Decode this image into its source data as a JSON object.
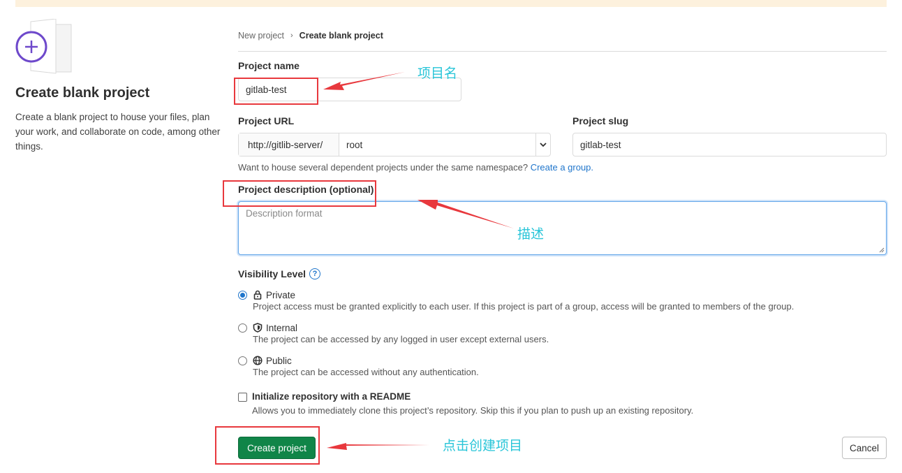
{
  "left": {
    "title": "Create blank project",
    "description": "Create a blank project to house your files, plan your work, and collaborate on code, among other things."
  },
  "breadcrumb": {
    "parent": "New project",
    "current": "Create blank project"
  },
  "form": {
    "project_name_label": "Project name",
    "project_name_value": "gitlab-test",
    "project_url_label": "Project URL",
    "url_prefix": "http://gitlib-server/",
    "namespace_value": "root",
    "project_slug_label": "Project slug",
    "project_slug_value": "gitlab-test",
    "namespace_help": "Want to house several dependent projects under the same namespace?",
    "namespace_help_link": "Create a group.",
    "description_label": "Project description (optional)",
    "description_placeholder": "Description format"
  },
  "visibility": {
    "label": "Visibility Level",
    "options": [
      {
        "title": "Private",
        "icon": "lock-icon",
        "desc": "Project access must be granted explicitly to each user. If this project is part of a group, access will be granted to members of the group.",
        "checked": true
      },
      {
        "title": "Internal",
        "icon": "shield-icon",
        "desc": "The project can be accessed by any logged in user except external users.",
        "checked": false
      },
      {
        "title": "Public",
        "icon": "globe-icon",
        "desc": "The project can be accessed without any authentication.",
        "checked": false
      }
    ]
  },
  "readme": {
    "title": "Initialize repository with a README",
    "desc": "Allows you to immediately clone this project’s repository. Skip this if you plan to push up an existing repository.",
    "checked": false
  },
  "buttons": {
    "create": "Create project",
    "cancel": "Cancel"
  },
  "annotations": {
    "project_name": "项目名",
    "description": "描述",
    "create": "点击创建项目",
    "colors": {
      "box": "#e8383d",
      "text": "#29c5d8"
    }
  }
}
